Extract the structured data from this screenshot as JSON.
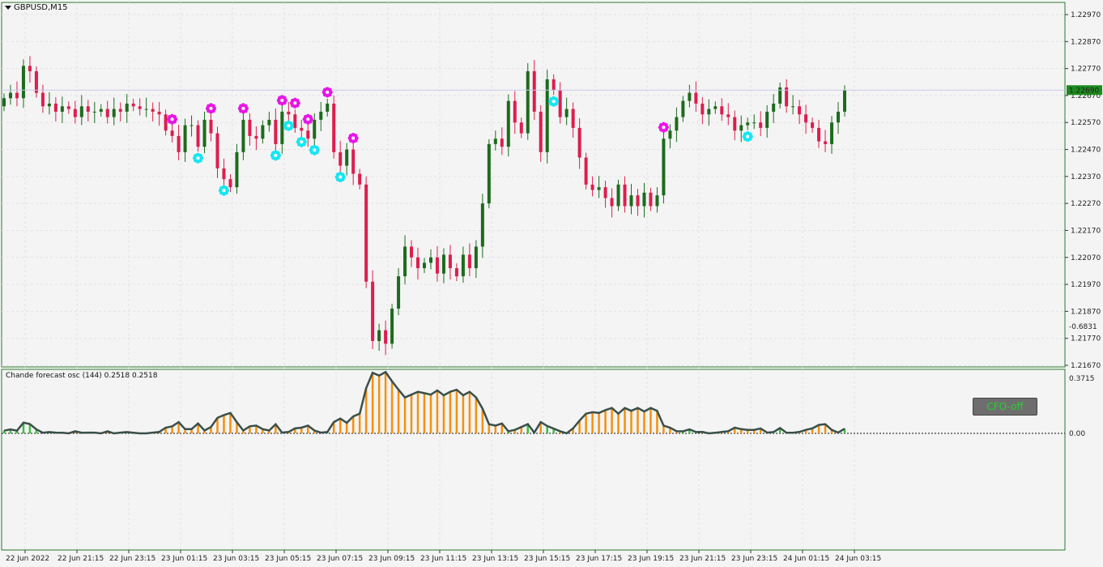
{
  "symbol_title": "GBPUSD,M15",
  "oscillator_title": "Chande forecast osc (144) 0.2518 0.2518",
  "cfo_button_label": "CFO-off",
  "colors": {
    "bull": "#1d6b1d",
    "bear": "#dc1e4f",
    "bull_hist": "#3fbf3f",
    "bear_hist": "#f5900c",
    "osc_line": "#3a4f4a",
    "buy_marker": "#16e6f0",
    "sell_marker": "#e815e8",
    "price_tag": "#1d8a1d"
  },
  "price_axis": {
    "labels": [
      "1.22970",
      "1.22870",
      "1.22770",
      "1.22670",
      "1.22570",
      "1.22470",
      "1.22370",
      "1.22270",
      "1.22170",
      "1.22070",
      "1.21970",
      "1.21870",
      "1.21770",
      "1.21670"
    ],
    "current_price": "1.22690"
  },
  "osc_axis": {
    "labels": [
      "0.3715",
      "0.00",
      "-0.6831"
    ]
  },
  "time_axis": {
    "labels": [
      "22 Jun 2022",
      "22 Jun 21:15",
      "22 Jun 23:15",
      "23 Jun 01:15",
      "23 Jun 03:15",
      "23 Jun 05:15",
      "23 Jun 07:15",
      "23 Jun 09:15",
      "23 Jun 11:15",
      "23 Jun 13:15",
      "23 Jun 15:15",
      "23 Jun 17:15",
      "23 Jun 19:15",
      "23 Jun 21:15",
      "23 Jun 23:15",
      "24 Jun 01:15",
      "24 Jun 03:15"
    ]
  },
  "chart_data": {
    "type": "candlestick",
    "title": "GBPUSD,M15",
    "ylim": [
      1.2167,
      1.2297
    ],
    "close": [
      1.2266,
      1.2268,
      1.2266,
      1.2278,
      1.2276,
      1.2268,
      1.2263,
      1.2264,
      1.2261,
      1.2263,
      1.2262,
      1.2259,
      1.2263,
      1.2261,
      1.2261,
      1.2262,
      1.2259,
      1.2262,
      1.2261,
      1.2264,
      1.2263,
      1.2262,
      1.2262,
      1.2261,
      1.226,
      1.2254,
      1.2252,
      1.2246,
      1.2256,
      1.2256,
      1.2248,
      1.2258,
      1.2253,
      1.224,
      1.2236,
      1.2233,
      1.2246,
      1.2258,
      1.2252,
      1.2251,
      1.2256,
      1.2258,
      1.2249,
      1.2261,
      1.226,
      1.2255,
      1.2254,
      1.2251,
      1.2258,
      1.2261,
      1.2264,
      1.2246,
      1.2241,
      1.2247,
      1.2238,
      1.2234,
      1.2198,
      1.2176,
      1.218,
      1.2175,
      1.2188,
      1.22,
      1.2211,
      1.2207,
      1.2203,
      1.2205,
      1.2207,
      1.2201,
      1.2208,
      1.2203,
      1.22,
      1.2208,
      1.2203,
      1.2211,
      1.2227,
      1.2249,
      1.2251,
      1.2248,
      1.2265,
      1.2257,
      1.2253,
      1.2276,
      1.2261,
      1.2246,
      1.2273,
      1.2269,
      1.2259,
      1.2262,
      1.2255,
      1.2244,
      1.2234,
      1.2232,
      1.2233,
      1.2229,
      1.2226,
      1.2234,
      1.2226,
      1.223,
      1.2226,
      1.2231,
      1.2226,
      1.223,
      1.2251,
      1.2254,
      1.2259,
      1.2265,
      1.2268,
      1.2264,
      1.226,
      1.2262,
      1.2263,
      1.226,
      1.2259,
      1.2254,
      1.2256,
      1.2257,
      1.2257,
      1.2255,
      1.2261,
      1.2264,
      1.227,
      1.2263,
      1.2263,
      1.226,
      1.2257,
      1.2255,
      1.225,
      1.2249,
      1.2257,
      1.2261,
      1.2269
    ]
  }
}
